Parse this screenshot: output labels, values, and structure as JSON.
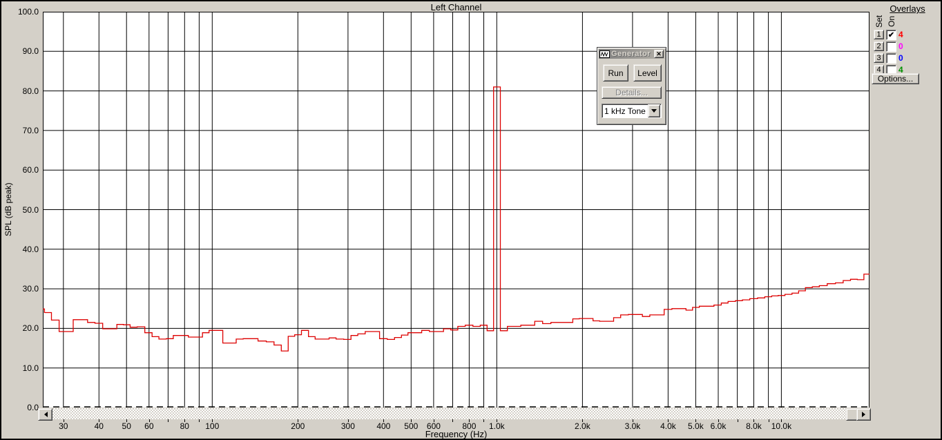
{
  "window": {
    "title": "Left Channel"
  },
  "chart_data": {
    "type": "line",
    "mode": "step-rta",
    "title": "Left Channel",
    "xlabel": "Frequency (Hz)",
    "ylabel": "SPL (dB peak)",
    "x_scale": "log",
    "xlim": [
      25.4,
      20400
    ],
    "ylim": [
      0,
      100
    ],
    "grid": true,
    "legend": "none",
    "y_ticks": [
      0,
      10,
      20,
      30,
      40,
      50,
      60,
      70,
      80,
      90,
      100
    ],
    "x_gridlines": [
      30,
      40,
      50,
      60,
      70,
      80,
      90,
      100,
      200,
      300,
      400,
      500,
      600,
      700,
      800,
      900,
      1000,
      2000,
      3000,
      4000,
      5000,
      6000,
      7000,
      8000,
      9000,
      10000
    ],
    "x_tick_labels": [
      {
        "f": 30,
        "label": "30"
      },
      {
        "f": 40,
        "label": "40"
      },
      {
        "f": 50,
        "label": "50"
      },
      {
        "f": 60,
        "label": "60"
      },
      {
        "f": 80,
        "label": "80"
      },
      {
        "f": 100,
        "label": "100"
      },
      {
        "f": 200,
        "label": "200"
      },
      {
        "f": 300,
        "label": "300"
      },
      {
        "f": 400,
        "label": "400"
      },
      {
        "f": 500,
        "label": "500"
      },
      {
        "f": 600,
        "label": "600"
      },
      {
        "f": 800,
        "label": "800"
      },
      {
        "f": 1000,
        "label": "1.0k"
      },
      {
        "f": 2000,
        "label": "2.0k"
      },
      {
        "f": 3000,
        "label": "3.0k"
      },
      {
        "f": 4000,
        "label": "4.0k"
      },
      {
        "f": 5000,
        "label": "5.0k"
      },
      {
        "f": 6000,
        "label": "6.0k"
      },
      {
        "f": 8000,
        "label": "8.0k"
      },
      {
        "f": 10000,
        "label": "10.0k"
      }
    ],
    "peak_annotation": {
      "frequency_hz": 1000,
      "level_db": 81.0,
      "note": "1 kHz tone spike"
    },
    "series": [
      {
        "name": "Overlay 1 RTA trace",
        "color": "#dd0000",
        "points": [
          [
            25,
            24.9
          ],
          [
            26.5,
            24.0
          ],
          [
            28,
            22.1
          ],
          [
            30,
            19.2
          ],
          [
            31.5,
            19.2
          ],
          [
            33.5,
            22.2
          ],
          [
            35.5,
            22.2
          ],
          [
            37.5,
            21.5
          ],
          [
            40,
            21.3
          ],
          [
            42.5,
            19.9
          ],
          [
            45,
            19.9
          ],
          [
            47.5,
            21.0
          ],
          [
            50,
            20.9
          ],
          [
            53,
            20.3
          ],
          [
            56,
            20.4
          ],
          [
            60,
            18.9
          ],
          [
            63,
            17.9
          ],
          [
            67,
            17.3
          ],
          [
            71,
            17.4
          ],
          [
            75,
            18.2
          ],
          [
            80,
            18.2
          ],
          [
            85,
            17.8
          ],
          [
            90,
            17.8
          ],
          [
            95,
            18.9
          ],
          [
            100,
            19.5
          ],
          [
            106,
            19.5
          ],
          [
            112,
            16.3
          ],
          [
            118,
            16.3
          ],
          [
            125,
            17.3
          ],
          [
            132,
            17.4
          ],
          [
            140,
            17.4
          ],
          [
            150,
            16.8
          ],
          [
            160,
            16.6
          ],
          [
            170,
            15.8
          ],
          [
            180,
            14.3
          ],
          [
            190,
            18.0
          ],
          [
            200,
            18.4
          ],
          [
            212,
            19.5
          ],
          [
            224,
            17.9
          ],
          [
            236,
            17.3
          ],
          [
            250,
            17.3
          ],
          [
            265,
            17.6
          ],
          [
            280,
            17.3
          ],
          [
            300,
            17.2
          ],
          [
            315,
            18.2
          ],
          [
            335,
            18.6
          ],
          [
            355,
            19.2
          ],
          [
            375,
            19.2
          ],
          [
            400,
            17.4
          ],
          [
            425,
            17.2
          ],
          [
            450,
            17.7
          ],
          [
            475,
            18.3
          ],
          [
            500,
            18.9
          ],
          [
            530,
            18.9
          ],
          [
            560,
            19.5
          ],
          [
            600,
            19.2
          ],
          [
            630,
            19.2
          ],
          [
            670,
            19.9
          ],
          [
            710,
            19.6
          ],
          [
            750,
            20.5
          ],
          [
            800,
            20.8
          ],
          [
            850,
            20.5
          ],
          [
            900,
            20.8
          ],
          [
            950,
            19.4
          ],
          [
            1000,
            81.0
          ],
          [
            1060,
            19.4
          ],
          [
            1120,
            20.5
          ],
          [
            1180,
            20.5
          ],
          [
            1250,
            20.8
          ],
          [
            1320,
            20.8
          ],
          [
            1400,
            21.8
          ],
          [
            1500,
            21.2
          ],
          [
            1600,
            21.5
          ],
          [
            1700,
            21.5
          ],
          [
            1800,
            21.5
          ],
          [
            1900,
            22.4
          ],
          [
            2000,
            22.5
          ],
          [
            2120,
            22.5
          ],
          [
            2240,
            21.9
          ],
          [
            2360,
            21.8
          ],
          [
            2500,
            21.8
          ],
          [
            2650,
            22.7
          ],
          [
            2800,
            23.4
          ],
          [
            3000,
            23.5
          ],
          [
            3150,
            23.5
          ],
          [
            3350,
            23.0
          ],
          [
            3550,
            23.4
          ],
          [
            3750,
            23.4
          ],
          [
            4000,
            24.8
          ],
          [
            4250,
            25.0
          ],
          [
            4500,
            25.0
          ],
          [
            4750,
            24.6
          ],
          [
            5000,
            25.3
          ],
          [
            5300,
            25.6
          ],
          [
            5600,
            25.6
          ],
          [
            6000,
            25.9
          ],
          [
            6300,
            26.4
          ],
          [
            6700,
            26.8
          ],
          [
            7100,
            27.0
          ],
          [
            7500,
            27.2
          ],
          [
            8000,
            27.5
          ],
          [
            8500,
            27.7
          ],
          [
            9000,
            28.0
          ],
          [
            9500,
            28.2
          ],
          [
            10000,
            28.3
          ],
          [
            10600,
            28.6
          ],
          [
            11200,
            28.9
          ],
          [
            11800,
            29.5
          ],
          [
            12500,
            30.3
          ],
          [
            13200,
            30.5
          ],
          [
            14000,
            30.8
          ],
          [
            15000,
            31.3
          ],
          [
            16000,
            31.5
          ],
          [
            17000,
            32.1
          ],
          [
            18000,
            32.4
          ],
          [
            19000,
            32.3
          ],
          [
            20000,
            33.7
          ]
        ]
      }
    ]
  },
  "generator": {
    "title": "Generator",
    "run_label": "Run",
    "level_label": "Level",
    "details_label": "Details...",
    "signal_value": "1 kHz Tone"
  },
  "overlays": {
    "title": "Overlays",
    "col_set": "Set",
    "col_on": "On",
    "rows": [
      {
        "set_label": "1",
        "checked": true,
        "value": "4",
        "color": "#ff0000"
      },
      {
        "set_label": "2",
        "checked": false,
        "value": "0",
        "color": "#ff00ff"
      },
      {
        "set_label": "3",
        "checked": false,
        "value": "0",
        "color": "#0000ff"
      },
      {
        "set_label": "4",
        "checked": false,
        "value": "4",
        "color": "#009000"
      }
    ],
    "options_label": "Options..."
  },
  "icons": {
    "close": "✕",
    "generator": "waveform",
    "scroll_left": "left-triangle",
    "scroll_right": "right-triangle",
    "dropdown": "down-triangle"
  },
  "colors": {
    "app_background": "#d4d0c8",
    "plot_background": "#ffffff",
    "gridline": "#000000",
    "trace": "#dd0000"
  }
}
